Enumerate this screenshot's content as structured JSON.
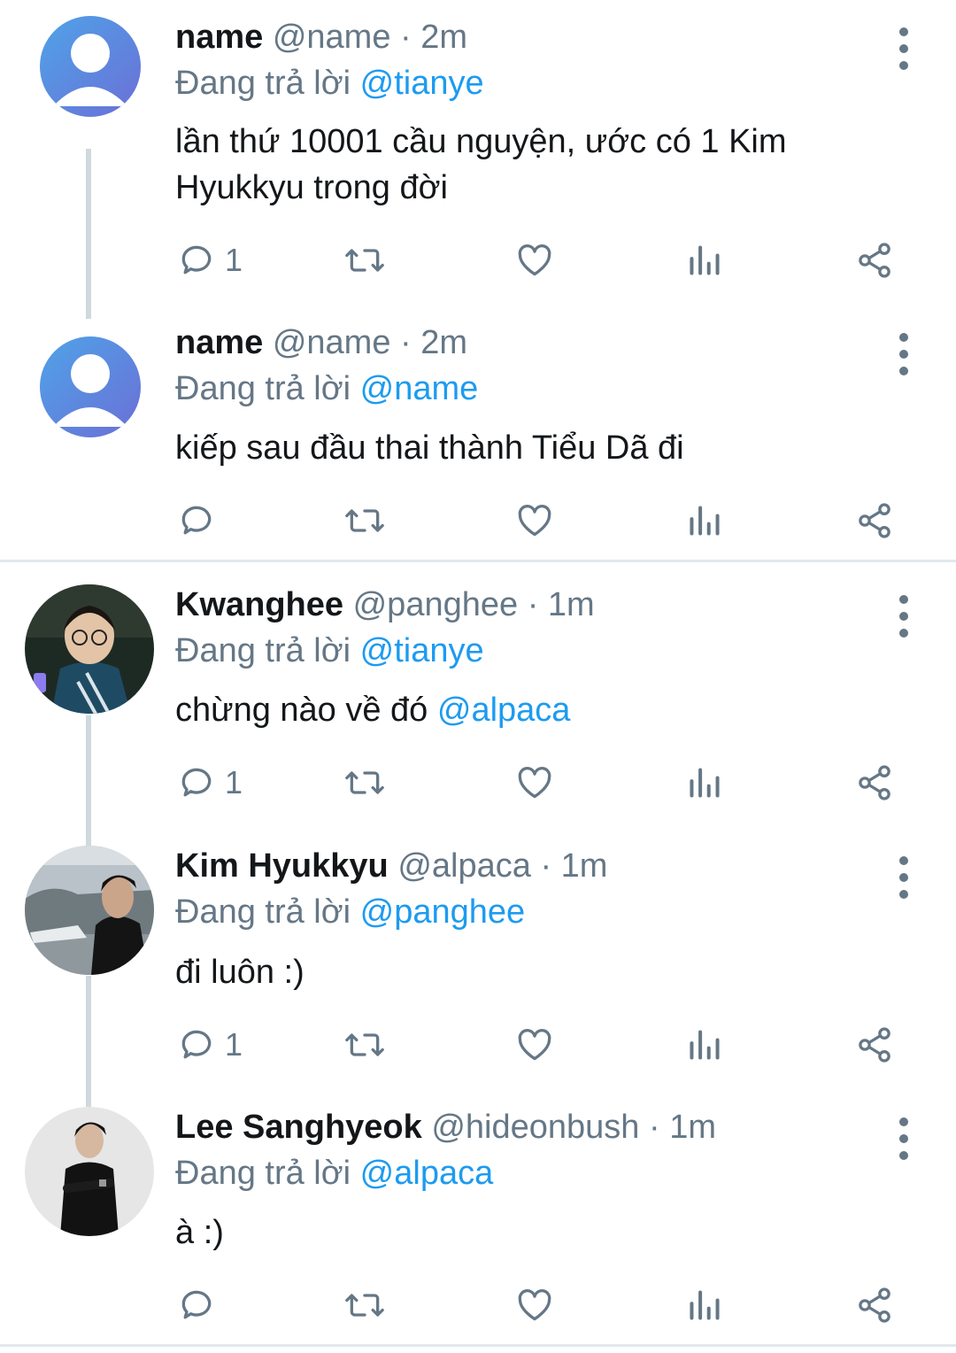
{
  "reply_prefix": "Đang trả lời",
  "tweets": [
    {
      "name": "name",
      "handle": "@name",
      "separator": "·",
      "time": "2m",
      "reply_to": "@tianye",
      "text": "lần thứ 10001 cầu nguyện, ước có 1 Kim Hyukkyu trong đời",
      "text_mention": "",
      "reply_count": "1"
    },
    {
      "name": "name",
      "handle": "@name",
      "separator": "·",
      "time": "2m",
      "reply_to": "@name",
      "text": "kiếp sau đầu thai thành Tiểu Dã đi",
      "text_mention": "",
      "reply_count": ""
    },
    {
      "name": "Kwanghee",
      "handle": "@panghee",
      "separator": "·",
      "time": "1m",
      "reply_to": "@tianye",
      "text": "chừng nào về đó",
      "text_mention": "@alpaca",
      "reply_count": "1"
    },
    {
      "name": "Kim Hyukkyu",
      "handle": "@alpaca",
      "separator": "·",
      "time": "1m",
      "reply_to": "@panghee",
      "text": "đi luôn :)",
      "text_mention": "",
      "reply_count": "1"
    },
    {
      "name": "Lee Sanghyeok",
      "handle": "@hideonbush",
      "separator": "·",
      "time": "1m",
      "reply_to": "@alpaca",
      "text": "à :)",
      "text_mention": "",
      "reply_count": ""
    }
  ],
  "icons": {
    "reply": "reply-icon",
    "retweet": "retweet-icon",
    "like": "heart-icon",
    "analytics": "analytics-icon",
    "share": "share-icon",
    "more": "more-vertical-icon"
  },
  "colors": {
    "mention": "#1d9bf0",
    "secondary": "#657786",
    "thread_line": "#cfd9de"
  }
}
